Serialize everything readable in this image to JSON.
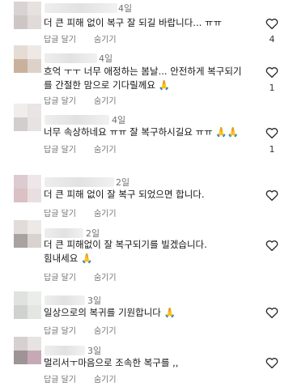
{
  "comments": [
    {
      "time": "4일",
      "text": "더 큰 피해 없이 복구 잘 되길 바랍니다... ㅠㅠ",
      "reply": "답글 달기",
      "hide": "숨기기",
      "likes": "4"
    },
    {
      "time": "4일",
      "text": "흐억 ㅜㅜ 너무 애정하는 봄날... 안전하게 복구되기\n를 간절한 맘으로 기다릴께요 🙏",
      "reply": "답글 달기",
      "hide": "숨기기",
      "likes": "1"
    },
    {
      "time": "4일",
      "text": "너무 속상하네요 ㅠㅠ 잘 복구하시길요 ㅠㅠ 🙏🙏",
      "reply": "답글 달기",
      "hide": "숨기기",
      "likes": "1"
    },
    {
      "time": "2일",
      "text": "더 큰 피해 없이 잘 복구 되었으면 합니다.",
      "reply": "답글 달기",
      "hide": "숨기기",
      "likes": ""
    },
    {
      "time": "2일",
      "text": "더 큰 피해없이 잘 복구되기를 빌겠습니다.\n힘내세요 🙏",
      "reply": "답글 달기",
      "hide": "숨기기",
      "likes": ""
    },
    {
      "time": "3일",
      "text": "일상으로의 복귀를 기원합니다 🙏",
      "reply": "답글 달기",
      "hide": "숨기기",
      "likes": ""
    },
    {
      "time": "3일",
      "text": "멀리서ㅜ마음으로 조속한 복구를 ,,",
      "reply": "답글 달기",
      "hide": "숨기기",
      "likes": ""
    }
  ]
}
